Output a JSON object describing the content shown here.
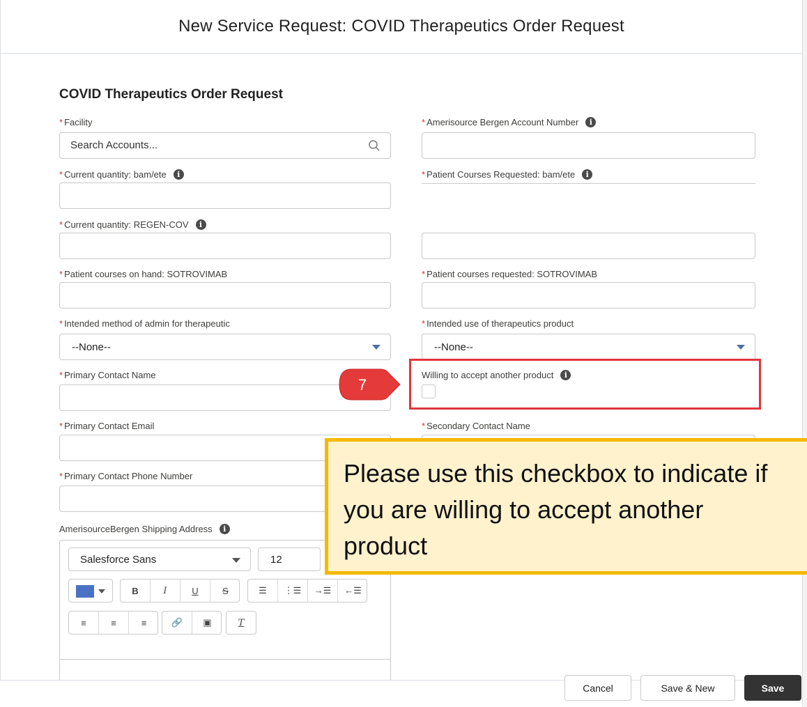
{
  "modal": {
    "title": "New Service Request: COVID Therapeutics Order Request"
  },
  "form": {
    "section_title": "COVID Therapeutics Order Request",
    "required_marker": "*",
    "facility": {
      "label": "Facility",
      "placeholder": "Search Accounts..."
    },
    "ab_account_number": {
      "label": "Amerisource Bergen Account Number"
    },
    "current_qty_bamete": {
      "label": "Current quantity: bam/ete"
    },
    "patient_courses_requested_bamete": {
      "label": "Patient Courses Requested: bam/ete"
    },
    "current_qty_regencov": {
      "label": "Current quantity: REGEN-COV"
    },
    "patient_courses_on_hand_sotrovimab": {
      "label": "Patient courses on hand: SOTROVIMAB"
    },
    "patient_courses_requested_sotrovimab": {
      "label": "Patient courses requested: SOTROVIMAB"
    },
    "intended_method_admin": {
      "label": "Intended method of admin for therapeutic",
      "value": "--None--"
    },
    "intended_use": {
      "label": "Intended use of therapeutics product",
      "value": "--None--"
    },
    "primary_contact_name": {
      "label": "Primary Contact Name"
    },
    "willing_accept": {
      "label": "Willing to accept another product",
      "checked": false
    },
    "primary_contact_email": {
      "label": "Primary Contact Email"
    },
    "secondary_contact_name": {
      "label": "Secondary Contact Name"
    },
    "primary_contact_phone": {
      "label": "Primary Contact Phone Number"
    },
    "shipping_address": {
      "label": "AmerisourceBergen Shipping Address",
      "font_family": "Salesforce Sans",
      "font_size": "12",
      "text_color": "#4a72c4"
    }
  },
  "info_icon_glyph": "i",
  "annotation": {
    "step_number": "7",
    "callout_text": "Please use this checkbox to indicate if you are willing to accept another product"
  },
  "footer": {
    "cancel": "Cancel",
    "save_new": "Save & New",
    "save": "Save"
  }
}
